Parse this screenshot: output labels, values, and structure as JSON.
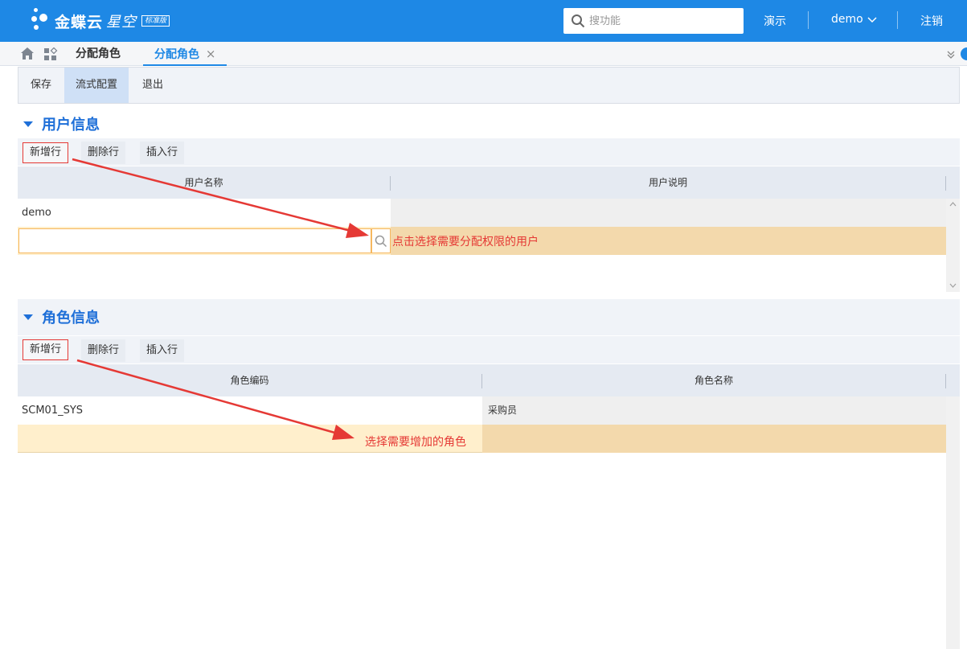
{
  "header": {
    "logo_text": "金蝶云",
    "logo_text2": "星空",
    "logo_badge": "标准版",
    "search_placeholder": "搜功能",
    "demo_link": "演示",
    "user_menu": "demo",
    "logout": "注销"
  },
  "tabs": [
    {
      "label": "分配角色"
    },
    {
      "label": "分配角色"
    }
  ],
  "toolbar": {
    "save": "保存",
    "flow_config": "流式配置",
    "exit": "退出"
  },
  "user_section": {
    "title": "用户信息",
    "buttons": {
      "add": "新增行",
      "delete": "删除行",
      "insert": "插入行"
    },
    "columns": [
      "用户名称",
      "用户说明"
    ],
    "rows": [
      {
        "name": "demo",
        "desc": ""
      }
    ],
    "editing_value": "",
    "annotation": "点击选择需要分配权限的用户"
  },
  "role_section": {
    "title": "角色信息",
    "buttons": {
      "add": "新增行",
      "delete": "删除行",
      "insert": "插入行"
    },
    "columns": [
      "角色编码",
      "角色名称"
    ],
    "rows": [
      {
        "code": "SCM01_SYS",
        "name": "采购员"
      }
    ],
    "annotation": "选择需要增加的角色"
  },
  "colors": {
    "brand_blue": "#1e88e5",
    "section_title": "#1e6fd8",
    "annotation_red": "#e53935",
    "row_highlight": "#ffefcc",
    "row_highlight_dark": "#f3d9ac"
  }
}
